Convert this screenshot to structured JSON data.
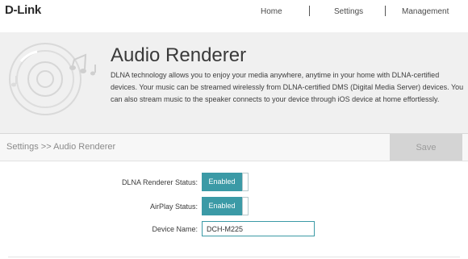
{
  "brand": {
    "logo_text": "D-Link"
  },
  "nav": {
    "items": [
      {
        "label": "Home"
      },
      {
        "label": "Settings"
      },
      {
        "label": "Management"
      }
    ]
  },
  "hero": {
    "title": "Audio Renderer",
    "description": "DLNA technology allows you to enjoy your media anywhere, anytime in your home with DLNA-certified devices. Your music can be streamed wirelessly from DLNA-certified DMS (Digital Media Server) devices. You can also stream music to the speaker connects to your device through iOS device at home effortlessly."
  },
  "breadcrumb": {
    "text": "Settings >> Audio Renderer"
  },
  "toolbar": {
    "save_label": "Save"
  },
  "form": {
    "dlna_label": "DLNA Renderer Status:",
    "dlna_value": "Enabled",
    "airplay_label": "AirPlay Status:",
    "airplay_value": "Enabled",
    "device_label": "Device Name:",
    "device_value": "DCH-M225"
  },
  "colors": {
    "accent": "#3b9aa6",
    "save_disabled_bg": "#d4d4d4",
    "hero_bg": "#f0f0f0"
  },
  "icons": [
    "music-disc-icon"
  ]
}
